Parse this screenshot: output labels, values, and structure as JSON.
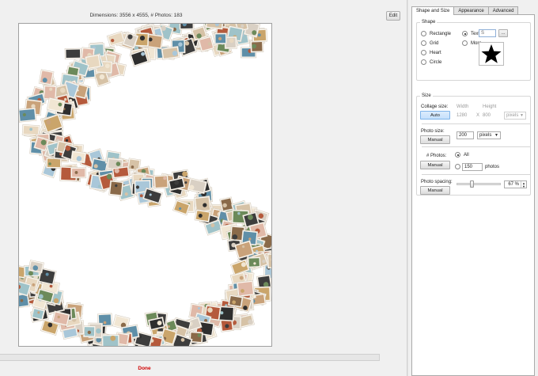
{
  "header": {
    "dimensions_text": "Dimensions: 3556 x 4555, # Photos: 183",
    "edit_label": "Edit"
  },
  "status": {
    "text": "Done",
    "color": "#d00000"
  },
  "tabs": [
    {
      "label": "Shape and Size",
      "active": true
    },
    {
      "label": "Appearance",
      "active": false
    },
    {
      "label": "Advanced",
      "active": false
    }
  ],
  "shape": {
    "group_title": "Shape",
    "options": [
      "Rectangle",
      "Grid",
      "Heart",
      "Circle"
    ],
    "text_option": "Text",
    "text_value": "S",
    "browse_label": "...",
    "more_option": "More",
    "selected": "Text",
    "preview_icon": "star-icon"
  },
  "size": {
    "group_title": "Size",
    "collage_size_label": "Collage size:",
    "collage_size_button": "Auto",
    "width_label": "Width",
    "height_label": "Height",
    "width_value": "1280",
    "x_label": "X",
    "height_value": "800",
    "collage_unit": "pixels",
    "photo_size_label": "Photo size:",
    "photo_size_button": "Manual",
    "photo_size_value": "200",
    "photo_size_unit": "pixels",
    "photos_label": "# Photos:",
    "photos_button": "Manual",
    "all_option": "All",
    "count_value": "150",
    "count_suffix": "photos",
    "spacing_label": "Photo spacing:",
    "spacing_button": "Manual",
    "spacing_value": "67 %",
    "spacing_fraction": 0.33
  },
  "colors": {
    "status_red": "#d00000",
    "pressed_blue": "#c4e0fc"
  }
}
